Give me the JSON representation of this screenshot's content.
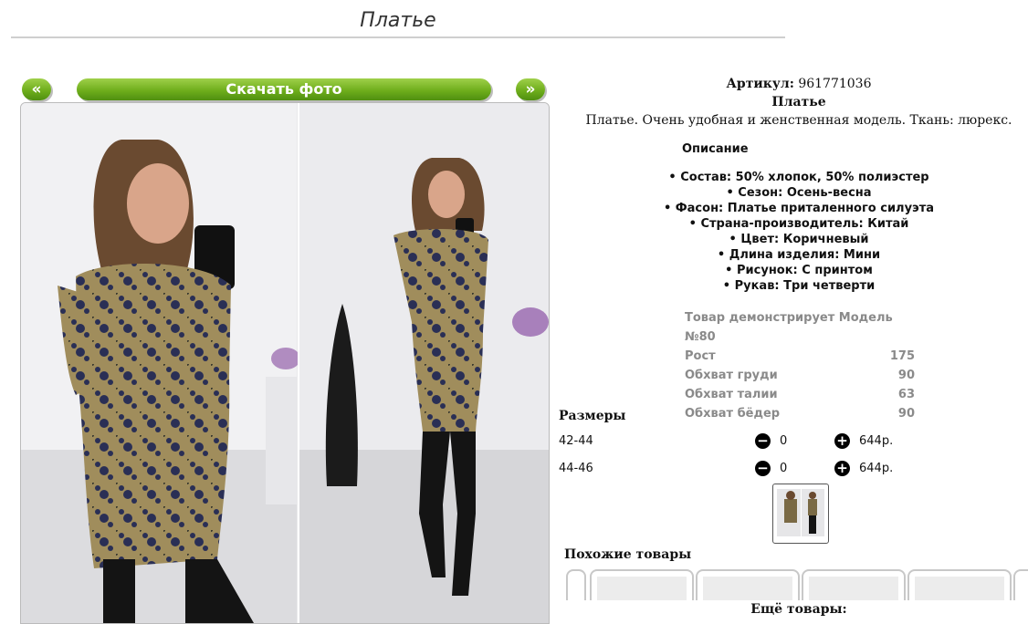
{
  "page": {
    "title": "Платье"
  },
  "gallery": {
    "prev_label": "«",
    "download_label": "Скачать фото",
    "next_label": "»"
  },
  "product": {
    "article_label": "Артикул:",
    "article_value": "961771036",
    "name": "Платье",
    "description": "Платье. Очень удобная и женственная модель. Ткань: люрекс."
  },
  "description_heading": "Описание",
  "properties": [
    "• Состав: 50% хлопок, 50% полиэстер",
    "• Сезон: Осень-весна",
    "• Фасон: Платье приталенного силуэта",
    "• Страна-производитель: Китай",
    "• Цвет: Коричневый",
    "• Длина изделия: Мини",
    "• Рисунок: С принтом",
    "• Рукав: Три четверти"
  ],
  "model": {
    "heading": "Товар демонстрирует Модель №80",
    "rows": [
      {
        "label": "Рост",
        "value": "175"
      },
      {
        "label": "Обхват груди",
        "value": "90"
      },
      {
        "label": "Обхват талии",
        "value": "63"
      },
      {
        "label": "Обхват бёдер",
        "value": "90"
      }
    ]
  },
  "sizes": {
    "heading": "Размеры",
    "rows": [
      {
        "size": "42-44",
        "qty": "0",
        "price": "644р."
      },
      {
        "size": "44-46",
        "qty": "0",
        "price": "644р."
      }
    ]
  },
  "icons": {
    "minus": "minus-circle-icon",
    "plus": "plus-circle-icon"
  },
  "similar_heading": "Похожие товары",
  "more_heading": "Ещё товары:",
  "colors": {
    "button_green": "#6fae1c",
    "model_text": "#8a8a8a"
  }
}
